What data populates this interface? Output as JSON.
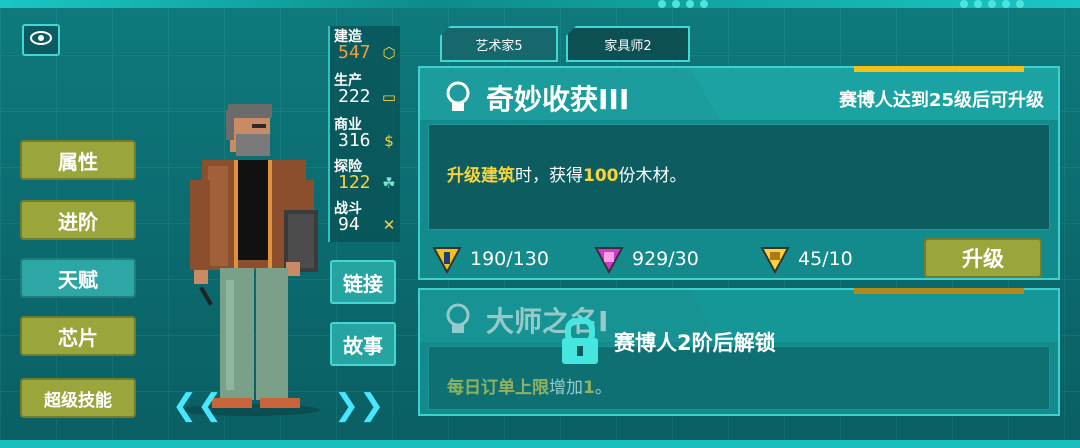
{
  "tabs": [
    {
      "label": "艺术家5"
    },
    {
      "label": "家具师2"
    }
  ],
  "left_menu": [
    "属性",
    "进阶",
    "天赋",
    "芯片",
    "超级技能"
  ],
  "stats": [
    {
      "label": "建造",
      "value": "547",
      "color": "#f2a03a",
      "icon": "cube-icon"
    },
    {
      "label": "生产",
      "value": "222",
      "color": "#ffffff",
      "icon": "screen-icon"
    },
    {
      "label": "商业",
      "value": "316",
      "color": "#ffffff",
      "icon": "coin-icon"
    },
    {
      "label": "探险",
      "value": "122",
      "color": "#f7d43a",
      "icon": "footprint-icon"
    },
    {
      "label": "战斗",
      "value": "94",
      "color": "#ffffff",
      "icon": "swords-icon"
    }
  ],
  "side_buttons": {
    "link": "链接",
    "story": "故事"
  },
  "talent1": {
    "title": "奇妙收获III",
    "requirement": "赛博人达到25级后可升级",
    "desc_hl1": "升级建筑",
    "desc_mid": "时，获得",
    "desc_hl2": "100",
    "desc_end": "份木材。",
    "resources": [
      {
        "value": "190/130",
        "color": "#f2c21a",
        "icon": "resource-gold-icon"
      },
      {
        "value": "929/30",
        "color": "#d13ad0",
        "icon": "resource-purple-icon"
      },
      {
        "value": "45/10",
        "color": "#f7d43a",
        "icon": "resource-crown-icon"
      }
    ],
    "upgrade_label": "升级"
  },
  "talent2": {
    "title": "大师之名I",
    "desc_hl": "每日订单上限",
    "desc_mid": "增加",
    "desc_hl2": "1",
    "desc_end": "。",
    "lock_text": "赛博人2阶后解锁"
  },
  "nav": {
    "prev": "❮❮",
    "next": "❯❯"
  }
}
